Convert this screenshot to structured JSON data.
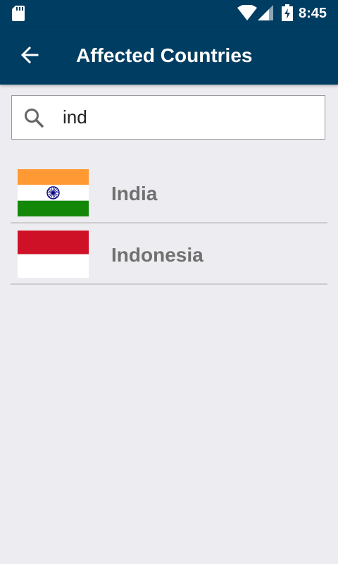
{
  "status_bar": {
    "time": "8:45",
    "icons": [
      "sd-card-icon",
      "wifi-icon",
      "signal-icon",
      "battery-charging-icon"
    ]
  },
  "app_bar": {
    "title": "Affected Countries",
    "back_icon": "arrow-back-icon",
    "background_color": "#003d62"
  },
  "search": {
    "value": "ind",
    "icon": "search-icon"
  },
  "countries": [
    {
      "name": "India",
      "flag": "india-flag"
    },
    {
      "name": "Indonesia",
      "flag": "indonesia-flag"
    }
  ],
  "colors": {
    "primary": "#003d62",
    "background": "#edecf1",
    "item_text": "#707070"
  }
}
